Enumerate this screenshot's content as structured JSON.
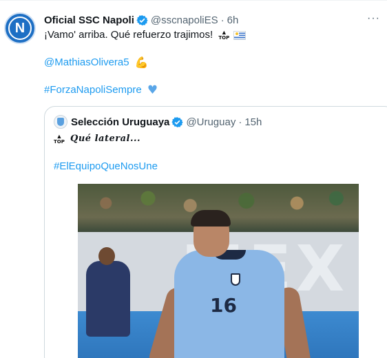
{
  "tweet": {
    "author_name": "Oficial SSC Napoli",
    "author_handle": "@sscnapoliES",
    "separator": "·",
    "time": "6h",
    "avatar_letter": "N",
    "text_line1": "¡Vamo' arriba. Qué refuerzo trajimos!",
    "top_label": "TOP",
    "mention": "@MathiasOlivera5",
    "hashtag": "#ForzaNapoliSempre",
    "more_glyph": "···",
    "icons": [
      "verified-icon",
      "top-emoji-icon",
      "uruguay-flag-icon",
      "muscle-emoji-icon",
      "blue-heart-emoji-icon",
      "more-icon"
    ]
  },
  "quote": {
    "author_name": "Selección Uruguaya",
    "author_handle": "@Uruguay",
    "separator": "·",
    "time": "15h",
    "top_label": "TOP",
    "text_line1": "𝑸𝒖é 𝒍𝒂𝒕𝒆𝒓𝒂𝒍...",
    "hashtag": "#ElEquipoQueNosUne",
    "photo_billboard_text": "MEX",
    "player_number": "16"
  },
  "colors": {
    "link": "#1d9bf0",
    "secondary_text": "#536471",
    "verified": "#1d9bf0",
    "border": "#cfd9de"
  }
}
